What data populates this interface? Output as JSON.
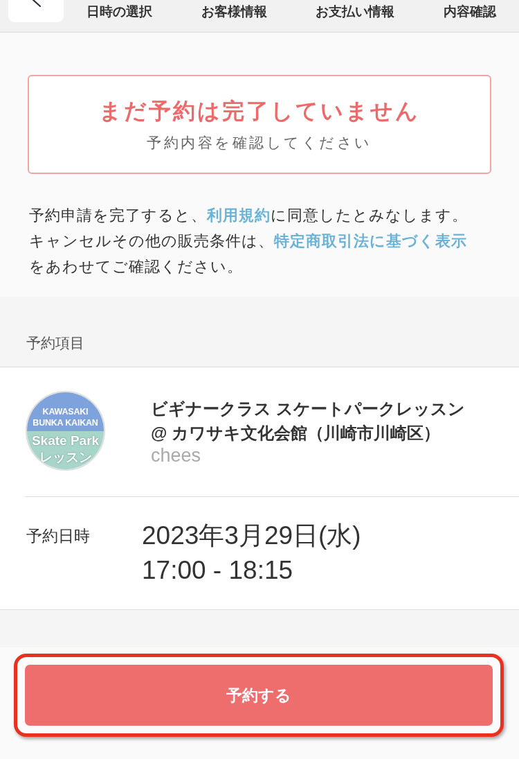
{
  "header": {
    "steps": [
      {
        "label": "日時の選択"
      },
      {
        "label": "お客様情報"
      },
      {
        "label": "お支払い情報"
      },
      {
        "label": "内容確認"
      }
    ]
  },
  "notice": {
    "title": "まだ予約は完了していません",
    "subtitle": "予約内容を確認してください"
  },
  "terms": [
    [
      {
        "kind": "text",
        "text": "予約申請を完了すると、"
      },
      {
        "kind": "link",
        "text": "利用規約"
      },
      {
        "kind": "text",
        "text": "に同意したとみなします。"
      }
    ],
    [
      {
        "kind": "text",
        "text": "キャンセルその他の販売条件は、"
      },
      {
        "kind": "link",
        "text": "特定商取引法に基づく表示"
      },
      {
        "kind": "text",
        "text": "をあわせてご確認ください。"
      }
    ]
  ],
  "reservation": {
    "section_label": "予約項目",
    "item": {
      "logo": {
        "top_lines": [
          "KAWASAKI",
          "BUNKA KAIKAN"
        ],
        "bottom_lines": [
          "Skate Park",
          "レッスン"
        ]
      },
      "title": "ビギナークラス スケートパークレッスン @ カワサキ文化会館（川崎市川崎区）",
      "organizer": "chees"
    },
    "details": [
      {
        "label": "予約日時",
        "lines": [
          "2023年3月29日(水)",
          "17:00 - 18:15"
        ]
      }
    ]
  },
  "submit_button": {
    "label": "予約する",
    "highlighted": true
  }
}
